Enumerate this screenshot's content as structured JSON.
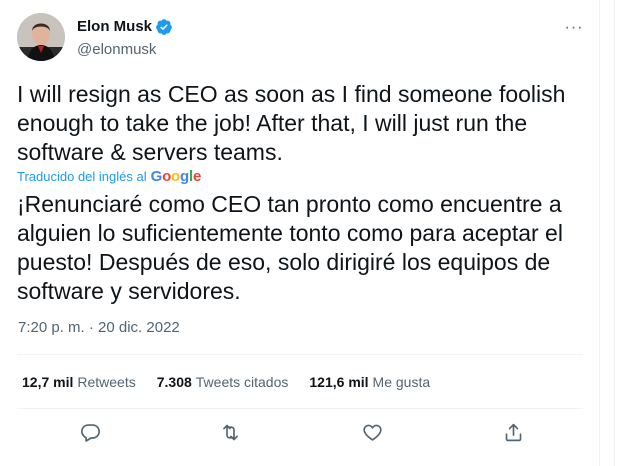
{
  "author": {
    "display_name": "Elon Musk",
    "handle": "@elonmusk",
    "verified": true,
    "avatar_icon": "profile-photo"
  },
  "more_icon": "more-horizontal-icon",
  "more_label": "···",
  "tweet": {
    "text": "I will resign as CEO as soon as I find someone foolish enough to take the job! After that, I will just run the software & servers teams.",
    "translated_by_label": "Traducido del inglés al",
    "translator": "Google",
    "translated_text": "¡Renunciaré como CEO tan pronto como encuentre a alguien lo suficientemente tonto como para aceptar el puesto! Después de eso, solo dirigiré los equipos de software y servidores.",
    "timestamp": "7:20 p. m. · 20 dic. 2022"
  },
  "stats": {
    "retweets_count": "12,7 mil",
    "retweets_label": "Retweets",
    "quotes_count": "7.308",
    "quotes_label": "Tweets citados",
    "likes_count": "121,6 mil",
    "likes_label": "Me gusta"
  },
  "actions": [
    {
      "icon": "reply-icon"
    },
    {
      "icon": "retweet-icon"
    },
    {
      "icon": "like-icon"
    },
    {
      "icon": "share-icon"
    }
  ],
  "colors": {
    "accent": "#1d9bf0",
    "text": "#0f1419",
    "secondary": "#536471",
    "divider": "#eff3f4"
  }
}
